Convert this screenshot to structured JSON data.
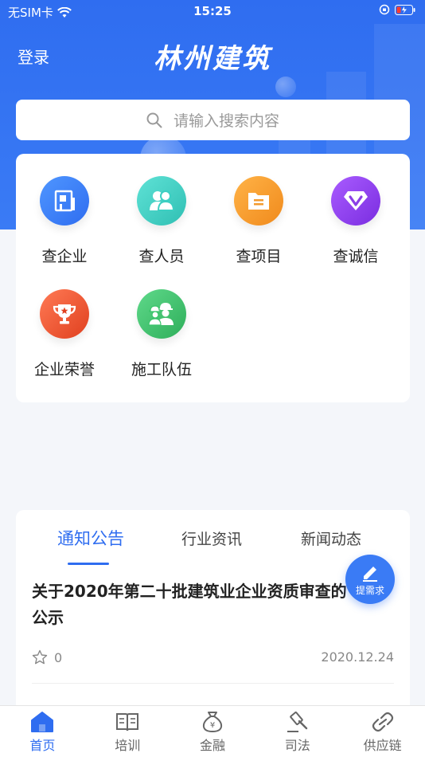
{
  "status_bar": {
    "carrier": "无SIM卡",
    "time": "15:25"
  },
  "header": {
    "login": "登录",
    "title": "林州建筑"
  },
  "search": {
    "placeholder": "请输入搜索内容"
  },
  "grid": {
    "items": [
      {
        "label": "查企业",
        "icon": "building-icon",
        "color": "#3b82f0"
      },
      {
        "label": "查人员",
        "icon": "people-icon",
        "color": "#3ccfc2"
      },
      {
        "label": "查项目",
        "icon": "folder-icon",
        "color": "#f39a2e"
      },
      {
        "label": "查诚信",
        "icon": "v-badge-icon",
        "color": "#8b3fe6"
      },
      {
        "label": "企业荣誉",
        "icon": "trophy-icon",
        "color": "#f0553a"
      },
      {
        "label": "施工队伍",
        "icon": "workers-icon",
        "color": "#39c46a"
      }
    ]
  },
  "news": {
    "tabs": [
      "通知公告",
      "行业资讯",
      "新闻动态"
    ],
    "active_tab": "通知公告",
    "items": [
      {
        "headline": "关于2020年第二十批建筑业企业资质审查的公示",
        "likes": "0",
        "date": "2020.12.24"
      }
    ]
  },
  "fab": {
    "label": "提需求"
  },
  "tabbar": {
    "items": [
      {
        "label": "首页",
        "icon": "home-icon",
        "active": true
      },
      {
        "label": "培训",
        "icon": "book-icon",
        "active": false
      },
      {
        "label": "金融",
        "icon": "money-bag-icon",
        "active": false
      },
      {
        "label": "司法",
        "icon": "gavel-icon",
        "active": false
      },
      {
        "label": "供应链",
        "icon": "link-icon",
        "active": false
      }
    ]
  },
  "colors": {
    "primary": "#2f6df0",
    "background": "#f4f6fa"
  }
}
